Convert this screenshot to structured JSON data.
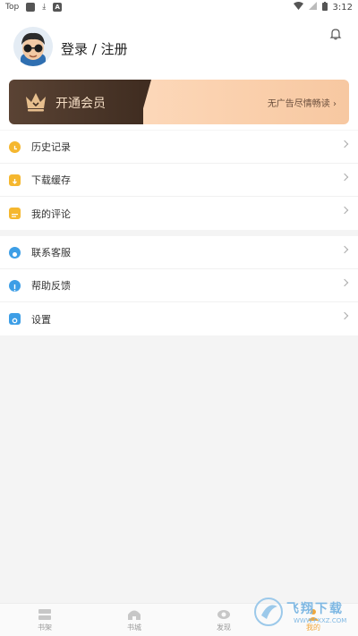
{
  "status_bar": {
    "left_label": "Top",
    "time": "3:12",
    "app_icon_letter": "A"
  },
  "profile": {
    "login_text": "登录 / 注册"
  },
  "vip": {
    "title": "开通会员",
    "subtitle": "无广告尽情畅读"
  },
  "menu_group_1": [
    {
      "label": "历史记录",
      "icon": "clock-icon",
      "color": "#f5b72f"
    },
    {
      "label": "下载缓存",
      "icon": "download-icon",
      "color": "#f5b72f"
    },
    {
      "label": "我的评论",
      "icon": "comment-icon",
      "color": "#f5b72f"
    }
  ],
  "menu_group_2": [
    {
      "label": "联系客服",
      "icon": "service-icon",
      "color": "#3d9ee6"
    },
    {
      "label": "帮助反馈",
      "icon": "help-icon",
      "color": "#3d9ee6"
    },
    {
      "label": "设置",
      "icon": "settings-icon",
      "color": "#3d9ee6"
    }
  ],
  "bottom_nav": [
    {
      "label": "书架",
      "icon": "bookshelf-icon"
    },
    {
      "label": "书城",
      "icon": "bookstore-icon"
    },
    {
      "label": "发现",
      "icon": "discover-icon"
    },
    {
      "label": "我的",
      "icon": "profile-icon"
    }
  ],
  "watermark": {
    "title": "飞翔下载",
    "url": "WWW.FXXZ.COM"
  },
  "colors": {
    "accent_yellow": "#f5b72f",
    "accent_blue": "#3d9ee6",
    "vip_dark": "#402d21",
    "vip_light": "#fbd2b0"
  }
}
